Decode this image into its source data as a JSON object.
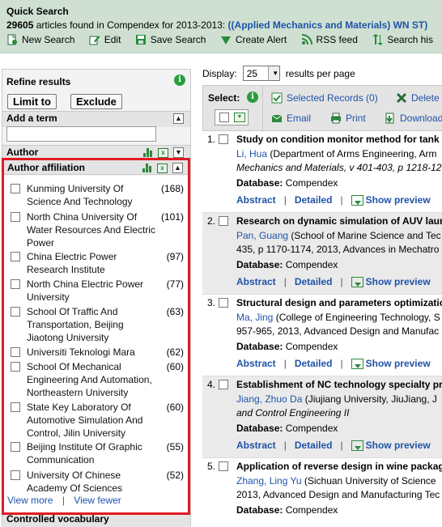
{
  "header": {
    "title": "Quick Search",
    "count": "29605",
    "summary_text": "articles found in Compendex for 2013-2013:",
    "query": "((Applied Mechanics and Materials) WN ST)",
    "toolbar": [
      {
        "label": "New Search",
        "icon": "new-search-icon"
      },
      {
        "label": "Edit",
        "icon": "edit-icon"
      },
      {
        "label": "Save Search",
        "icon": "save-search-icon"
      },
      {
        "label": "Create Alert",
        "icon": "alert-icon"
      },
      {
        "label": "RSS feed",
        "icon": "rss-icon"
      },
      {
        "label": "Search his",
        "icon": "search-history-icon"
      }
    ]
  },
  "refine": {
    "title": "Refine results",
    "limit_label": "Limit to",
    "exclude_label": "Exclude",
    "add_term_label": "Add a term",
    "add_term_value": "",
    "author_label": "Author",
    "affiliation_label": "Author affiliation",
    "affiliations": [
      {
        "name": "Kunming University Of Science And Technology",
        "count": "(168)"
      },
      {
        "name": "North China University Of Water Resources And Electric Power",
        "count": "(101)"
      },
      {
        "name": "China Electric Power Research Institute",
        "count": "(97)"
      },
      {
        "name": "North China Electric Power University",
        "count": "(77)"
      },
      {
        "name": "School Of Traffic And Transportation, Beijing Jiaotong University",
        "count": "(63)"
      },
      {
        "name": "Universiti Teknologi Mara",
        "count": "(62)"
      },
      {
        "name": "School Of Mechanical Engineering And Automation, Northeastern University",
        "count": "(60)"
      },
      {
        "name": "State Key Laboratory Of Automotive Simulation And Control, Jilin University",
        "count": "(60)"
      },
      {
        "name": "Beijing Institute Of Graphic Communication",
        "count": "(55)"
      },
      {
        "name": "University Of Chinese Academy Of Sciences",
        "count": "(52)"
      }
    ],
    "view_more": "View more",
    "view_fewer": "View fewer",
    "controlled_vocab_label": "Controlled vocabulary"
  },
  "display": {
    "label": "Display:",
    "value": "25",
    "suffix": "results per page"
  },
  "selection": {
    "label": "Select:",
    "selected_records": "Selected Records (0)",
    "delete": "Delete",
    "email": "Email",
    "print": "Print",
    "download": "Download"
  },
  "results": [
    {
      "num": "1.",
      "title": "Study on condition monitor method for tank g",
      "author": "Li, Hua",
      "line1_rest": " (Department of Arms Engineering, Arm",
      "line2": "Mechanics and Materials, v 401-403, p 1218-12",
      "db_label": "Database:",
      "db": "Compendex"
    },
    {
      "num": "2.",
      "title": "Research on dynamic simulation of AUV launc",
      "author": "Pan, Guang",
      "line1_rest": " (School of Marine Science and Tec",
      "line2": "435, p 1170-1174, 2013, Advances in Mechatro",
      "db_label": "Database:",
      "db": "Compendex"
    },
    {
      "num": "3.",
      "title": "Structural design and parameters optimizatio",
      "author": "Ma, Jing",
      "line1_rest": " (College of Engineering Technology, S",
      "line2": "957-965, 2013, Advanced Design and Manufac",
      "db_label": "Database:",
      "db": "Compendex"
    },
    {
      "num": "4.",
      "title": "Establishment of NC technology specialty pra",
      "author": "Jiang, Zhuo Da",
      "line1_rest": " (Jiujiang University, JiuJiang, J",
      "line2": "and Control Engineering II",
      "db_label": "Database:",
      "db": "Compendex"
    },
    {
      "num": "5.",
      "title": "Application of reverse design in wine packagi",
      "author": "Zhang, Ling Yu",
      "line1_rest": " (Sichuan University of Science",
      "line2": "2013, Advanced Design and Manufacturing Tec",
      "db_label": "Database:",
      "db": "Compendex"
    }
  ],
  "result_links": {
    "abstract": "Abstract",
    "detailed": "Detailed",
    "preview": "Show preview",
    "separator": "|"
  },
  "colors": {
    "header_bg": "#cfe0d2",
    "link": "#1f53a8",
    "highlight_border": "#e11b22",
    "icon_green": "#2a8a3a"
  }
}
